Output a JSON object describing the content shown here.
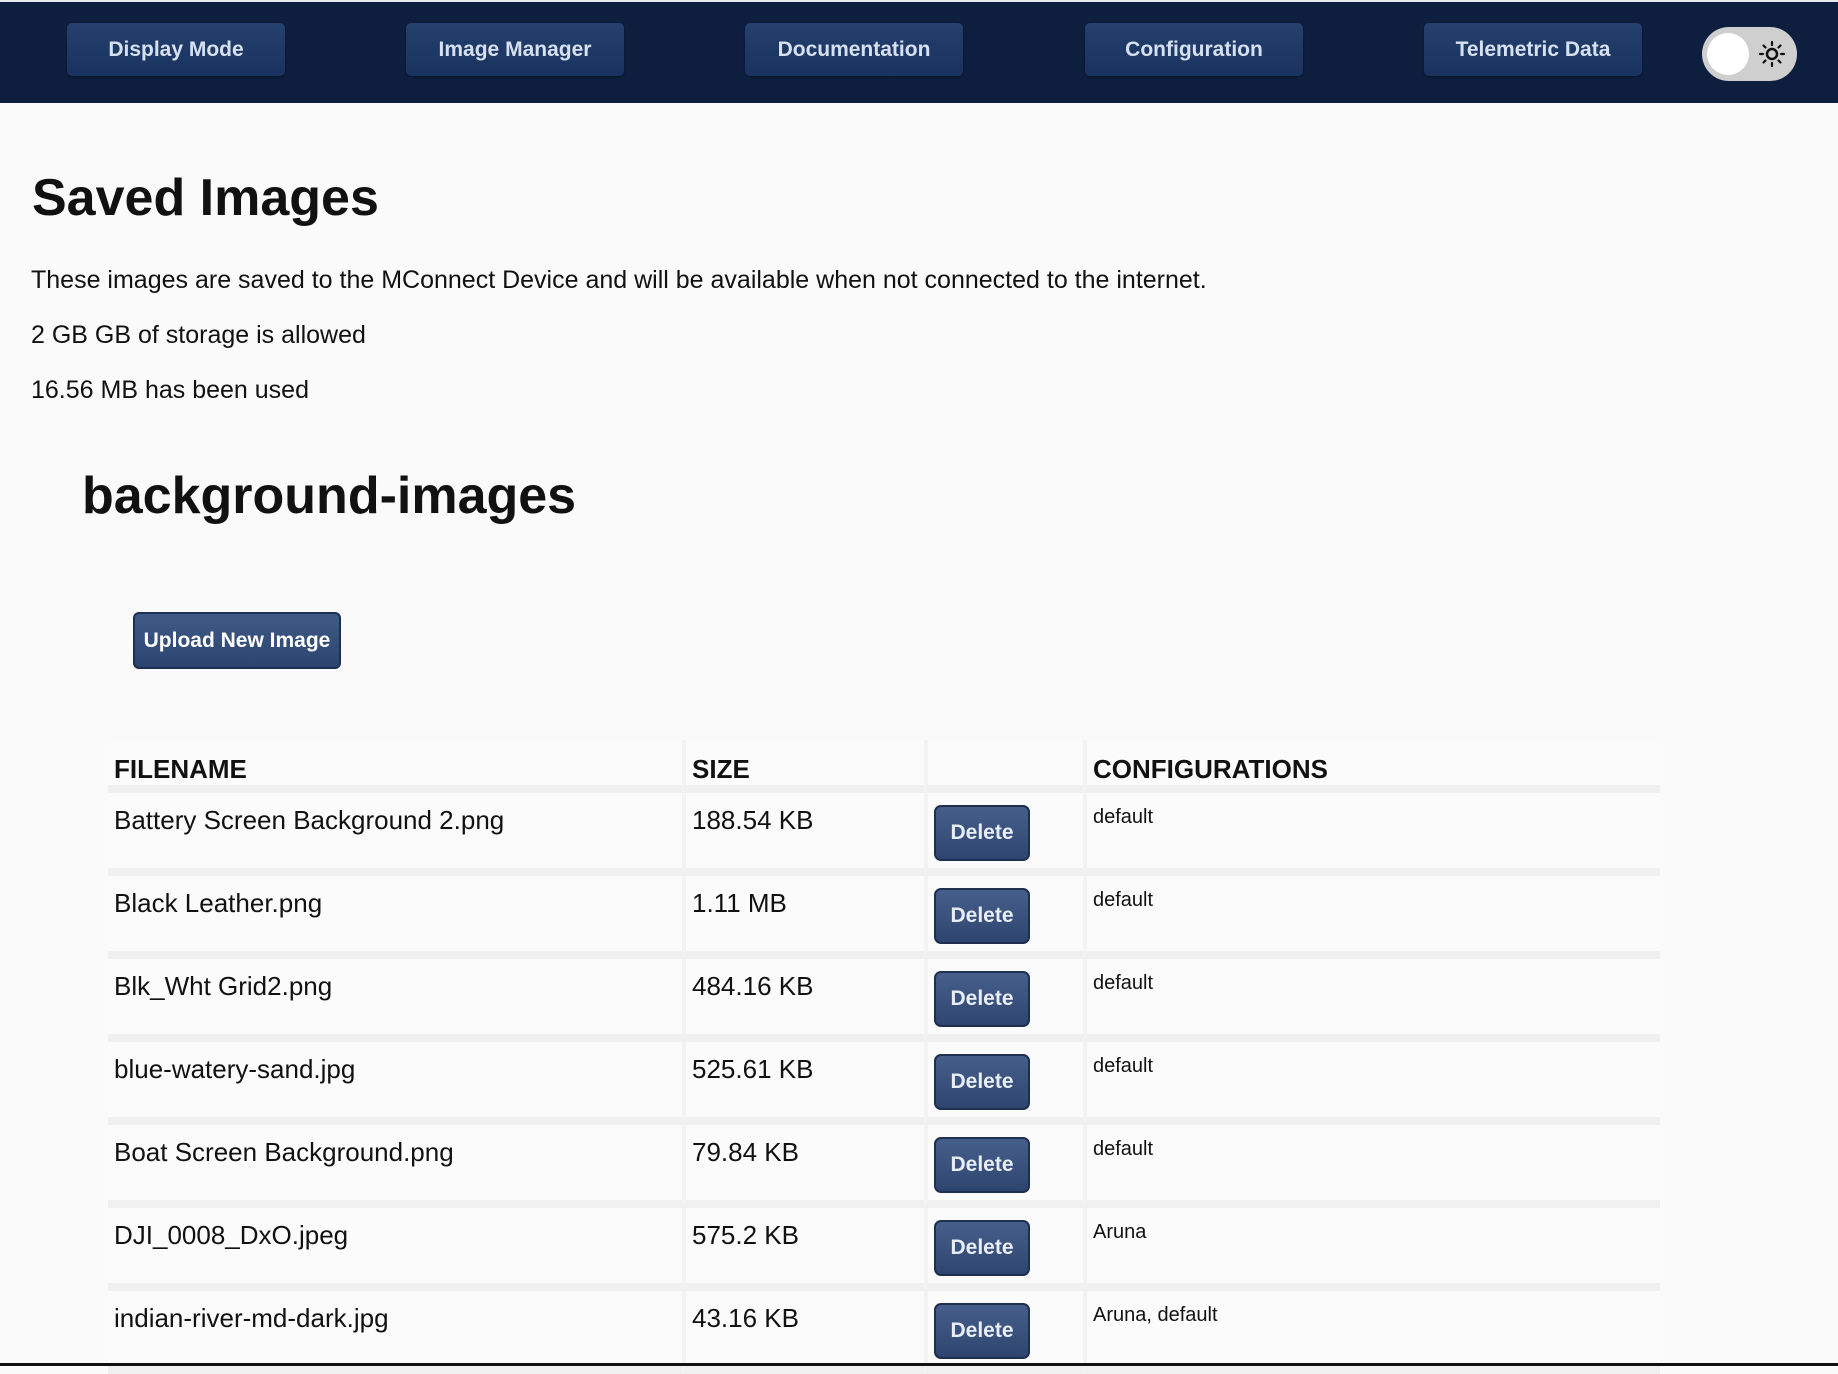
{
  "nav": {
    "items": [
      {
        "label": "Display Mode"
      },
      {
        "label": "Image Manager"
      },
      {
        "label": "Documentation"
      },
      {
        "label": "Configuration"
      },
      {
        "label": "Telemetric Data"
      }
    ],
    "theme_toggle": {
      "icon": "sun-icon",
      "state": "light"
    }
  },
  "page": {
    "title": "Saved Images",
    "description": "These images are saved to the MConnect Device and will be available when not connected to the internet.",
    "storage_allowed": "2 GB GB of storage is allowed",
    "storage_used": "16.56 MB has been used"
  },
  "section": {
    "title": "background-images",
    "upload_label": "Upload New Image"
  },
  "table": {
    "headers": {
      "filename": "FILENAME",
      "size": "SIZE",
      "action": "",
      "configurations": "CONFIGURATIONS"
    },
    "delete_label": "Delete",
    "rows": [
      {
        "filename": "Battery Screen Background 2.png",
        "size": "188.54 KB",
        "configurations": "default"
      },
      {
        "filename": "Black Leather.png",
        "size": "1.11 MB",
        "configurations": "default"
      },
      {
        "filename": "Blk_Wht Grid2.png",
        "size": "484.16 KB",
        "configurations": "default"
      },
      {
        "filename": "blue-watery-sand.jpg",
        "size": "525.61 KB",
        "configurations": "default"
      },
      {
        "filename": "Boat Screen Background.png",
        "size": "79.84 KB",
        "configurations": "default"
      },
      {
        "filename": "DJI_0008_DxO.jpeg",
        "size": "575.2 KB",
        "configurations": "Aruna"
      },
      {
        "filename": "indian-river-md-dark.jpg",
        "size": "43.16 KB",
        "configurations": "Aruna, default"
      }
    ]
  },
  "colors": {
    "nav_bg": "#0e1e3e",
    "button": "#2e4570",
    "page_bg": "#fafafa"
  }
}
